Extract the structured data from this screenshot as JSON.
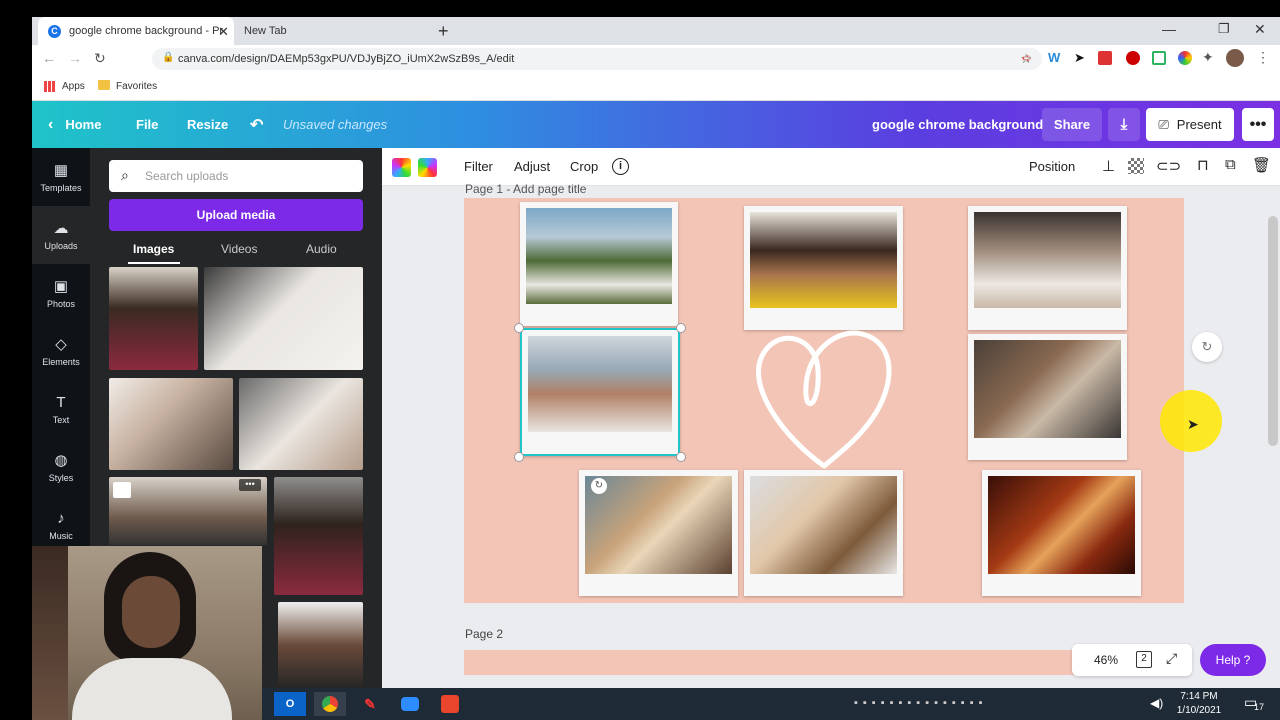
{
  "browser": {
    "tab1_title": "google chrome background - Pr",
    "tab2_title": "New Tab",
    "url": "canva.com/design/DAEMp53gxPU/VDJyBjZO_iUmX2wSzB9s_A/edit",
    "bookmarks": [
      "Apps",
      "Favorites"
    ]
  },
  "header": {
    "home": "Home",
    "file": "File",
    "resize": "Resize",
    "unsaved": "Unsaved changes",
    "design_title": "google chrome background",
    "share": "Share",
    "present": "Present"
  },
  "sidebar": {
    "items": [
      {
        "label": "Templates",
        "icon": "templates-icon"
      },
      {
        "label": "Uploads",
        "icon": "cloud-upload-icon"
      },
      {
        "label": "Photos",
        "icon": "image-icon"
      },
      {
        "label": "Elements",
        "icon": "shapes-icon"
      },
      {
        "label": "Text",
        "icon": "text-icon"
      },
      {
        "label": "Styles",
        "icon": "palette-icon"
      },
      {
        "label": "Music",
        "icon": "music-icon"
      }
    ]
  },
  "panel": {
    "search_placeholder": "Search uploads",
    "upload_button": "Upload media",
    "tabs": [
      "Images",
      "Videos",
      "Audio"
    ]
  },
  "toolbar": {
    "filter": "Filter",
    "adjust": "Adjust",
    "crop": "Crop",
    "position": "Position"
  },
  "canvas": {
    "page1_label": "Page 1 - Add page title",
    "page2_label": "Page 2"
  },
  "footer": {
    "zoom": "46%",
    "pages": "2",
    "help": "Help ?"
  },
  "taskbar": {
    "time": "7:14 PM",
    "date": "1/10/2021",
    "notifications": "17"
  },
  "colors": {
    "brand_purple": "#7d2ae8",
    "page_bg": "#f2c5b6",
    "selection": "#20c4cb"
  }
}
